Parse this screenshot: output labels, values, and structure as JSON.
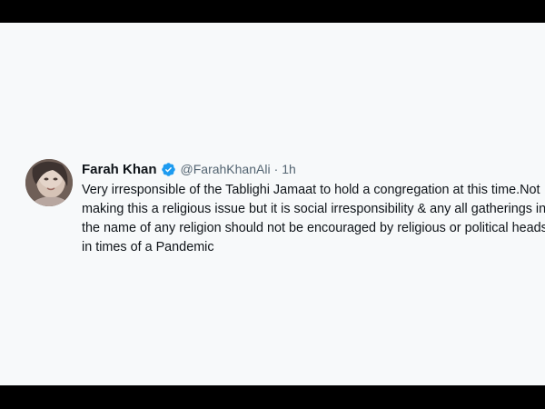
{
  "tweet": {
    "name": "Farah Khan",
    "handle": "@FarahKhanAli",
    "separator": "·",
    "time": "1h",
    "text": "Very irresponsible of the Tablighi Jamaat to hold a congregation at this time.Not making this a religious issue but it is social irresponsibility & any all gatherings in the name of any religion should not be encouraged by religious or political heads in times of a Pandemic"
  },
  "colors": {
    "panel_background": "#f7f9fa",
    "frame": "#000000",
    "verified_badge": "#1d9bf0",
    "secondary_text": "#536471",
    "primary_text": "#0f1419"
  },
  "icons": {
    "verified": "verified-badge-icon",
    "avatar": "profile-avatar"
  }
}
